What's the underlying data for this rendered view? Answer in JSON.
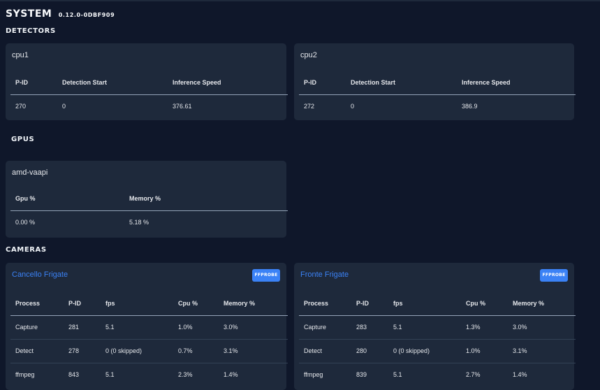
{
  "system": {
    "title": "SYSTEM",
    "version": "0.12.0-0DBF909"
  },
  "detectors": {
    "heading": "DETECTORS",
    "columns": [
      "P-ID",
      "Detection Start",
      "Inference Speed"
    ],
    "cards": [
      {
        "name": "cpu1",
        "pid": "270",
        "detection_start": "0",
        "inference_speed": "376.61"
      },
      {
        "name": "cpu2",
        "pid": "272",
        "detection_start": "0",
        "inference_speed": "386.9"
      }
    ]
  },
  "gpus": {
    "heading": "GPUS",
    "columns": [
      "Gpu %",
      "Memory %"
    ],
    "cards": [
      {
        "name": "amd-vaapi",
        "gpu": "0.00 %",
        "memory": "5.18 %"
      }
    ]
  },
  "cameras": {
    "heading": "CAMERAS",
    "ffprobe_label": "FFPROBE",
    "columns": [
      "Process",
      "P-ID",
      "fps",
      "Cpu %",
      "Memory %"
    ],
    "cards": [
      {
        "name": "Cancello Frigate",
        "rows": [
          {
            "process": "Capture",
            "pid": "281",
            "fps": "5.1",
            "cpu": "1.0%",
            "memory": "3.0%"
          },
          {
            "process": "Detect",
            "pid": "278",
            "fps": "0 (0 skipped)",
            "cpu": "0.7%",
            "memory": "3.1%"
          },
          {
            "process": "ffmpeg",
            "pid": "843",
            "fps": "5.1",
            "cpu": "2.3%",
            "memory": "1.4%"
          }
        ]
      },
      {
        "name": "Fronte Frigate",
        "rows": [
          {
            "process": "Capture",
            "pid": "283",
            "fps": "5.1",
            "cpu": "1.3%",
            "memory": "3.0%"
          },
          {
            "process": "Detect",
            "pid": "280",
            "fps": "0 (0 skipped)",
            "cpu": "1.0%",
            "memory": "3.1%"
          },
          {
            "process": "ffmpeg",
            "pid": "839",
            "fps": "5.1",
            "cpu": "2.7%",
            "memory": "1.4%"
          }
        ]
      }
    ]
  }
}
